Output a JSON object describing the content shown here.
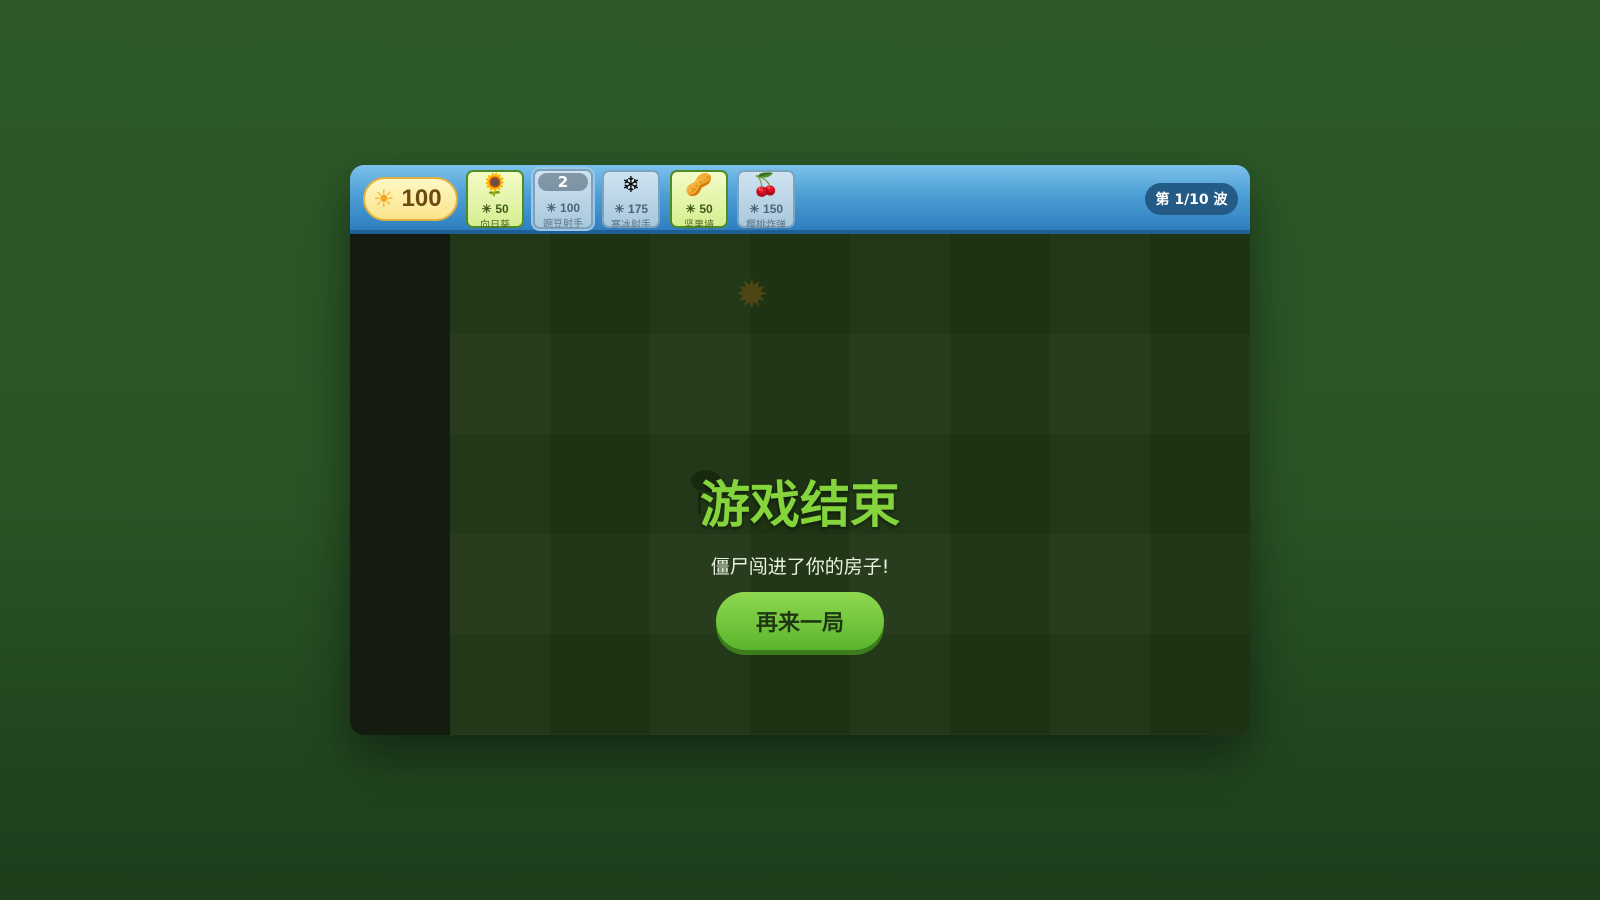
{
  "topbar": {
    "sun": {
      "icon": "sun-icon",
      "value": "100"
    },
    "cards": [
      {
        "name": "向日葵",
        "cost": "50",
        "icon": "sunflower-icon",
        "art": "🌻",
        "state": "available"
      },
      {
        "name": "豌豆射手",
        "cost": "100",
        "icon": "peashooter-icon",
        "art": "",
        "state": "cooldown",
        "cooldown": "2"
      },
      {
        "name": "寒冰射手",
        "cost": "175",
        "icon": "snow-pea-icon",
        "art": "❄",
        "state": "unaffordable"
      },
      {
        "name": "坚果墙",
        "cost": "50",
        "icon": "wallnut-icon",
        "art": "🥜",
        "state": "available"
      },
      {
        "name": "樱桃炸弹",
        "cost": "150",
        "icon": "cherry-bomb-icon",
        "art": "🍒",
        "state": "unaffordable"
      }
    ],
    "wave": "第 1/10 波"
  },
  "overlay": {
    "title": "游戏结束",
    "message": "僵尸闯进了你的房子!",
    "retry_label": "再来一局"
  },
  "colors": {
    "accent_green": "#86d43c",
    "topbar_blue": "#4e9fd6",
    "sun_yellow": "#f5a623"
  }
}
